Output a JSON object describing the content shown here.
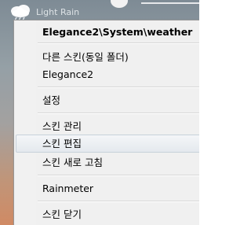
{
  "widget": {
    "weather_text": "Light Rain",
    "icon": "cloud-rain-icon"
  },
  "menu": {
    "title": "Elegance2\\System\\weather",
    "items": [
      {
        "label": "다른 스킨(동일 폴더)"
      },
      {
        "label": "Elegance2"
      },
      {
        "label": "설정"
      },
      {
        "label": "스킨 관리"
      },
      {
        "label": "스킨 편집"
      },
      {
        "label": "스킨 새로 고침"
      },
      {
        "label": "Rainmeter"
      },
      {
        "label": "스킨 닫기"
      }
    ],
    "hovered": "스킨 편집"
  }
}
